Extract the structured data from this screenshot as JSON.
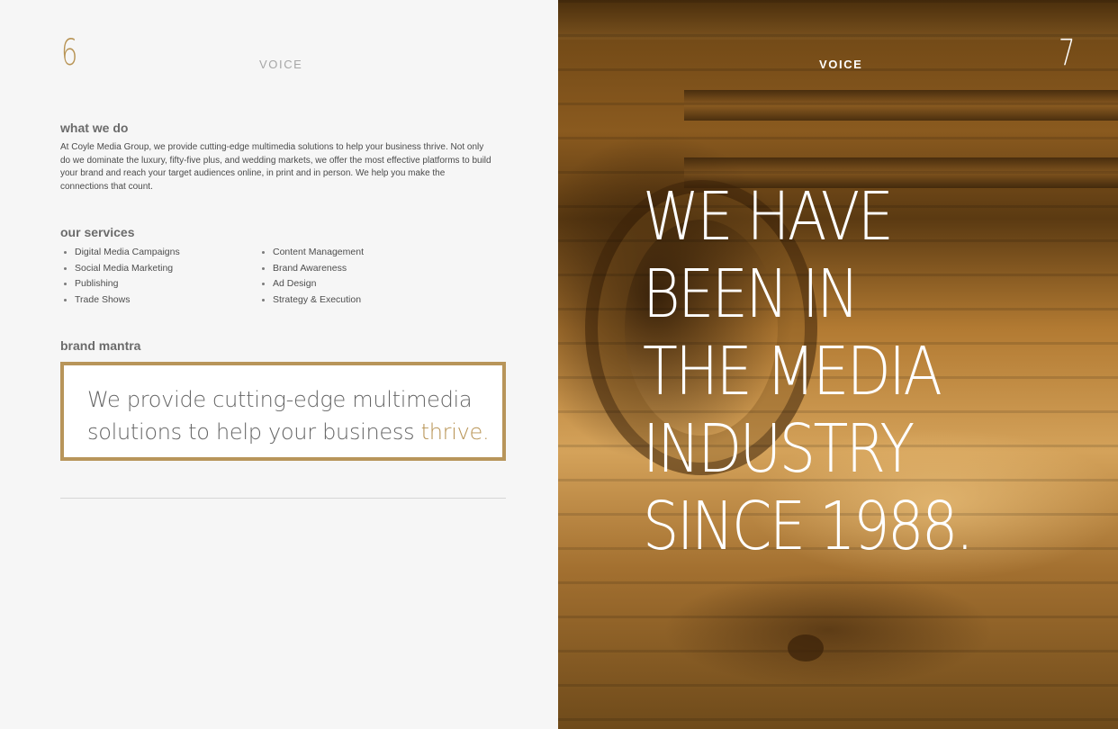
{
  "left_page": {
    "page_number": "6",
    "section_label": "VOICE",
    "what_we_do": {
      "heading": "what we do",
      "body": "At Coyle Media Group, we provide cutting-edge multimedia solutions to help your business thrive. Not only do we dominate the luxury, fifty-five plus, and wedding markets, we offer the most effective platforms to build your brand and reach your target audiences online, in print and in person. We help you make the connections that count."
    },
    "our_services": {
      "heading": "our services",
      "items": [
        "Digital Media Campaigns",
        "Content Management",
        "Social Media Marketing",
        "Brand Awareness",
        "Publishing",
        "Ad Design",
        "Trade Shows",
        "Strategy & Execution"
      ]
    },
    "brand_mantra": {
      "heading": "brand mantra",
      "text": "We provide cutting-edge multimedia solutions to help your business",
      "accent_word": "thrive."
    }
  },
  "right_page": {
    "page_number": "7",
    "section_label": "VOICE",
    "headline": "WE HAVE\nBEEN IN\nTHE MEDIA\nINDUSTRY\nSINCE 1988."
  },
  "colors": {
    "accent_gold": "#b89455",
    "text_gray": "#666666",
    "page_background": "#f6f6f6"
  }
}
